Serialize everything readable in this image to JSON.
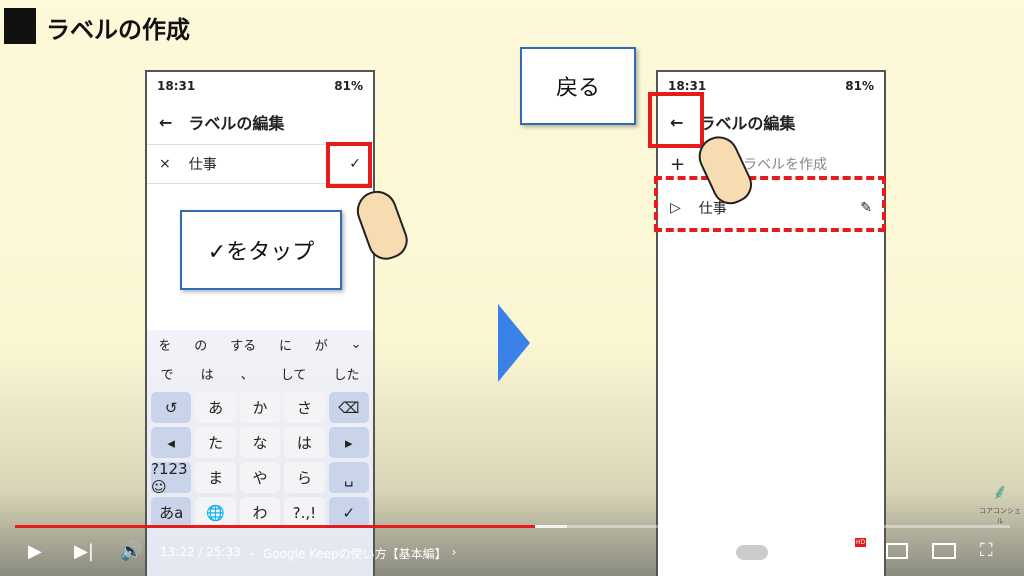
{
  "slide": {
    "title": "ラベルの作成"
  },
  "left_phone": {
    "time": "18:31",
    "battery": "81%",
    "header": "ラベルの編集",
    "back_icon": "←",
    "clear_icon": "×",
    "input_value": "仕事",
    "confirm_icon": "✓",
    "suggestions_row1": [
      "を",
      "の",
      "する",
      "に",
      "が",
      "⌄"
    ],
    "suggestions_row2": [
      "で",
      "は",
      "、",
      "して",
      "した"
    ],
    "keys": [
      "↺",
      "あ",
      "か",
      "さ",
      "⌫",
      "◂",
      "た",
      "な",
      "は",
      "▸",
      "?123 ☺",
      "ま",
      "や",
      "ら",
      "␣",
      "あa",
      "🌐",
      "わ",
      "?.,!",
      "✓"
    ]
  },
  "right_phone": {
    "time": "18:31",
    "battery": "81%",
    "header": "ラベルの編集",
    "back_icon": "←",
    "create_label": "ラベルを作成",
    "label_item": "仕事"
  },
  "callouts": {
    "tap_check": "✓をタップ",
    "go_back": "戻る"
  },
  "player": {
    "time": "13:22 / 25:33",
    "separator": "・",
    "video_title": "Google Keepの使い方【基本編】",
    "chevron": "›",
    "progress_fraction": 0.523,
    "buffer_fraction": 0.555,
    "hd_badge": "HD",
    "channel_logo": "コアコンシェル",
    "accent": "#e51c1c"
  }
}
